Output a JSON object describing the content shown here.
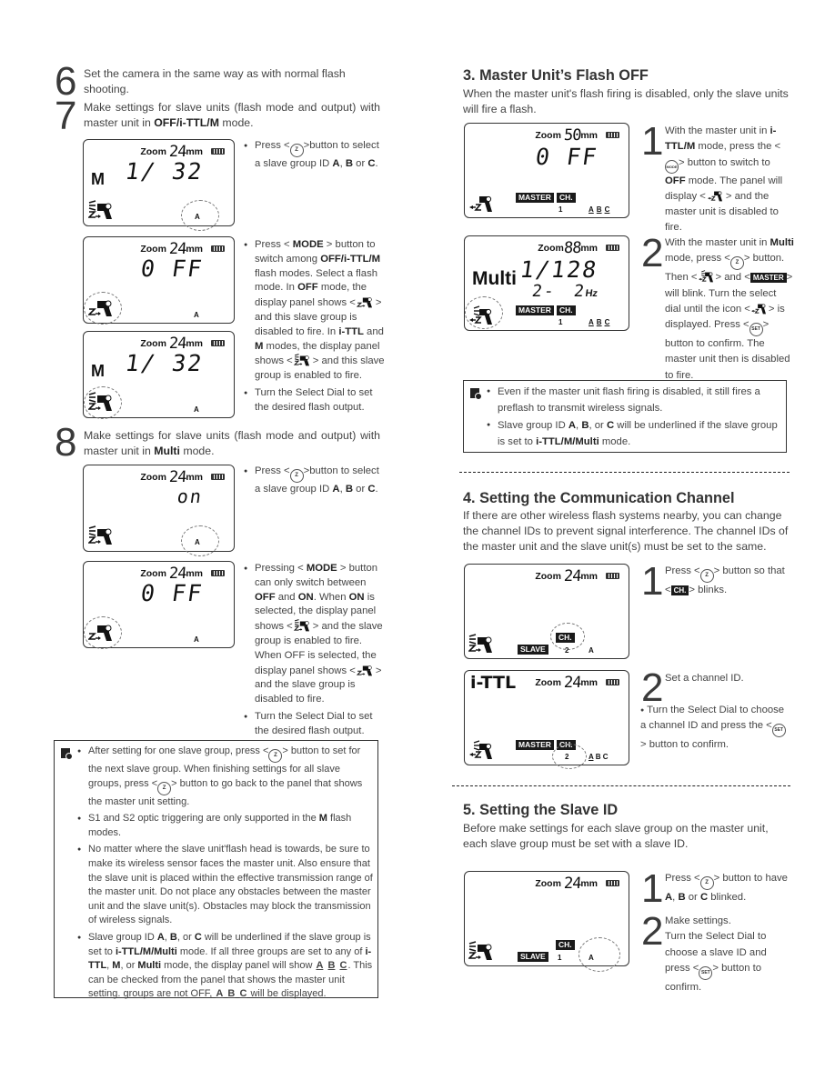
{
  "left": {
    "step6": {
      "num": "6",
      "text": "Set the camera in the same way as with normal flash shooting."
    },
    "step7": {
      "num": "7",
      "text_a": "Make settings for slave units (flash mode and output) with master unit in ",
      "text_bold": "OFF/i-TTL/M",
      "text_b": " mode."
    },
    "lcd1": {
      "zoom_label": "Zoom",
      "zoom_value": "24",
      "zoom_unit": "mm",
      "mode": "M",
      "value": "1/ 32",
      "group": "A"
    },
    "bullet1": {
      "a": "Press <",
      "b": ">button to select a slave group ID ",
      "A": "A",
      "sep1": ",",
      "B": "B",
      "or": " or ",
      "C": "C",
      "end": "."
    },
    "lcd2": {
      "zoom_label": "Zoom",
      "zoom_value": "24",
      "zoom_unit": "mm",
      "value": "0 FF",
      "group": "A"
    },
    "lcd3": {
      "zoom_label": "Zoom",
      "zoom_value": "24",
      "zoom_unit": "mm",
      "mode": "M",
      "value": "1/ 32",
      "group": "A"
    },
    "bullet2": {
      "p1": "Press < ",
      "mode": "MODE",
      "p2": " > button to switch among ",
      "modes": "OFF/i-TTL/M",
      "p3": " flash modes. Select a flash mode. In ",
      "off": "OFF",
      "p4": " mode, the display panel shows <",
      "p5": "> and this slave group is disabled to fire. In ",
      "ittl": "i-TTL",
      "p6": " and ",
      "m": "M",
      "p7": " modes, the display panel shows <",
      "p8": "> and this slave group is enabled to fire."
    },
    "bullet3": "Turn the Select Dial to set the desired flash output.",
    "step8": {
      "num": "8",
      "text_a": "Make settings for slave units (flash mode and output) with master unit in ",
      "text_bold": "Multi",
      "text_b": " mode."
    },
    "lcd4": {
      "zoom_label": "Zoom",
      "zoom_value": "24",
      "zoom_unit": "mm",
      "value": "on",
      "group": "A"
    },
    "bullet4": {
      "a": "Press <",
      "b": ">button to select a slave group ID ",
      "A": "A",
      "B": "B",
      "or": " or ",
      "C": "C"
    },
    "lcd5": {
      "zoom_label": "Zoom",
      "zoom_value": "24",
      "zoom_unit": "mm",
      "value": "0 FF",
      "group": "A"
    },
    "bullet5": {
      "p1": "Pressing < ",
      "mode": "MODE",
      "p2": " > button can only switch between ",
      "off": "OFF",
      "p3": " and ",
      "on": "ON",
      "p4": ". When ",
      "on2": "ON",
      "p5": " is selected, the display panel shows <",
      "p6": "> and the slave group is enabled to fire. When OFF is selected, the display panel shows <",
      "p7": "> and the slave group is disabled to fire."
    },
    "bullet6": "Turn the Select Dial to set the desired flash output.",
    "note": {
      "b1a": "After setting for one slave group, press <",
      "b1b": "> button to set for the next slave group. When finishing settings for all slave groups, press <",
      "b1c": "> button to go back to the panel that shows the master unit setting.",
      "b2a": "S1 and S2 optic triggering are only supported in the ",
      "b2m": "M",
      "b2b": " flash modes.",
      "b3": "No matter where the slave unit'flash head is towards, be sure to make its wireless sensor faces the master unit. Also ensure that the slave unit is placed within the effective transmission range of the master unit. Do not place any obstacles between the master unit and the slave unit(s). Obstacles may block the transmission of wireless signals.",
      "b4a": "Slave group ID ",
      "A": "A",
      "B": "B",
      "C": "C",
      "b4b": " will be underlined if the slave group is set to ",
      "modes": "i-TTL/M/Multi",
      "b4c": " mode. If all three groups are set to any of ",
      "ittl": "i-TTL",
      "m": "M",
      "multi": "Multi",
      "b4d": " mode, the display panel will show ",
      "b4e": ". This can be checked from the panel that shows the master unit setting. groups are not OFF, ",
      "b4f": " will be displayed."
    }
  },
  "right": {
    "sec3": {
      "title": "3. Master Unit’s Flash OFF",
      "intro": "When the master unit's flash firing is disabled, only the slave units will fire a flash.",
      "lcd1": {
        "zoom_label": "Zoom",
        "zoom_value": "50",
        "zoom_unit": "mm",
        "value": "0 FF",
        "tag_master": "MASTER",
        "tag_ch": "CH.",
        "channel": "1",
        "groups": [
          "A",
          "B",
          "C"
        ]
      },
      "step1": {
        "num": "1",
        "a": "With the master unit in ",
        "b": "i-TTL/M",
        "c": " mode, press the <",
        "mode_btn": "MODE",
        "d": "> button to switch to ",
        "off": "OFF",
        "e": " mode. The panel will display <",
        "f": "> and the master unit is disabled to fire."
      },
      "lcd2": {
        "zoom_label": "Zoom",
        "zoom_value": "88",
        "zoom_unit": "mm",
        "mode": "Multi",
        "value": "1/128",
        "freq_times": "2-",
        "freq_hz": "2",
        "hz": "Hz",
        "tag_master": "MASTER",
        "tag_ch": "CH.",
        "channel": "1",
        "groups": [
          "A",
          "B",
          "C"
        ]
      },
      "step2": {
        "num": "2",
        "a": "With the master unit in ",
        "multi": "Multi",
        "b": " mode, press <",
        "c": "> button. Then <",
        "d": "> and <",
        "master": "MASTER",
        "e": "> will blink. Turn the select dial until the icon <",
        "f": "> is displayed. Press <",
        "set": "SET",
        "g": "> button to confirm. The master unit then is disabled to fire."
      },
      "note": {
        "b1": "Even if the master unit flash firing is disabled, it still fires a preflash to transmit wireless signals.",
        "b2a": "Slave group ID ",
        "A": "A",
        "B": "B",
        "C": "C",
        "b2b": " will be underlined if the slave group is set to ",
        "modes": "i-TTL/M/Multi",
        "b2c": " mode."
      }
    },
    "sec4": {
      "title": "4. Setting the Communication Channel",
      "intro": "If there are other wireless flash systems nearby, you can change the channel IDs to prevent signal interference. The channel IDs of the master unit and the slave unit(s) must be set to the same.",
      "lcd1": {
        "zoom_label": "Zoom",
        "zoom_value": "24",
        "zoom_unit": "mm",
        "tag_ch": "CH.",
        "tag_slave": "SLAVE",
        "channel": "2",
        "group": "A"
      },
      "step1": {
        "num": "1",
        "a": "Press <",
        "b": "> button so that <",
        "ch": "CH.",
        "c": "> blinks."
      },
      "lcd2": {
        "mode": "i-TTL",
        "zoom_label": "Zoom",
        "zoom_value": "24",
        "zoom_unit": "mm",
        "tag_master": "MASTER",
        "tag_ch": "CH.",
        "channel": "2",
        "groups": [
          "A",
          "B",
          "C"
        ]
      },
      "step2": {
        "num": "2",
        "text": "Set a channel ID.",
        "bullet_a": "Turn the Select Dial to choose a channel ID and press the <",
        "set": "SET",
        "bullet_b": "> button to confirm."
      }
    },
    "sec5": {
      "title": "5. Setting the Slave ID",
      "intro": "Before make settings for each slave group on the master unit, each slave group must be set with a slave ID.",
      "lcd1": {
        "zoom_label": "Zoom",
        "zoom_value": "24",
        "zoom_unit": "mm",
        "tag_ch": "CH.",
        "tag_slave": "SLAVE",
        "channel": "1",
        "group": "A"
      },
      "step1": {
        "num": "1",
        "a": "Press <",
        "b": "> button to have ",
        "A": "A",
        "sep": ", ",
        "B": "B",
        "or": " or ",
        "C": "C",
        "c": " blinked."
      },
      "step2": {
        "num": "2",
        "a": "Make settings.",
        "b": "Turn the Select Dial to choose a slave ID and press <",
        "set": "SET",
        "c": "> button to confirm."
      }
    }
  },
  "icons": {
    "wireless_btn": "Z",
    "mode_btn": "MODE",
    "set_btn": "SET"
  }
}
